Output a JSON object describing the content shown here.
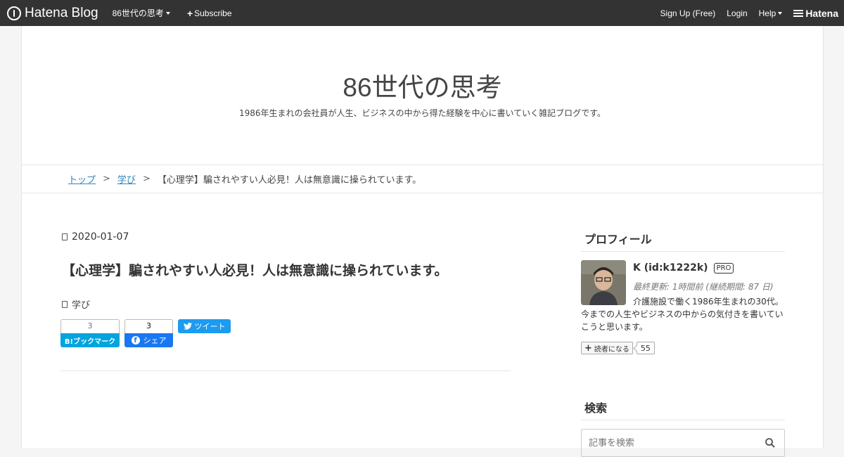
{
  "global_header": {
    "logo_text": "Hatena Blog",
    "blog_menu_label": "86世代の思考",
    "subscribe_label": "Subscribe",
    "signup_label": "Sign Up (Free)",
    "login_label": "Login",
    "help_label": "Help",
    "hatena_label": "Hatena"
  },
  "blog": {
    "title": "86世代の思考",
    "description": "1986年生まれの会社員が人生、ビジネスの中から得た経験を中心に書いていく雑記ブログです。"
  },
  "breadcrumb": {
    "items": [
      "トップ",
      "学び"
    ],
    "separator": ">",
    "current": "【心理学】騙されやすい人必見！人は無意識に操られています。"
  },
  "article": {
    "date": "2020-01-07",
    "title": "【心理学】騙されやすい人必見！人は無意識に操られています。",
    "category": "学び",
    "share": {
      "hatebu_count": "3",
      "hatebu_label": "B!ブックマーク",
      "facebook_count": "3",
      "facebook_label": "シェア",
      "twitter_label": "ツイート"
    }
  },
  "sidebar": {
    "profile": {
      "heading": "プロフィール",
      "name": "K (id:k1222k)",
      "badge": "PRO",
      "updated": "最終更新: 1時間前 (継続期間: 87 日)",
      "description": "介護施設で働く1986年生まれの30代。今までの人生やビジネスの中からの気付きを書いていこうと思います。",
      "subscribe_label": "読者になる",
      "subscriber_count": "55"
    },
    "search": {
      "heading": "検索",
      "placeholder": "記事を検索"
    }
  },
  "colors": {
    "header_bg": "#333333",
    "link": "#2e86b9",
    "hatebu": "#00a4de",
    "facebook": "#1877f2",
    "twitter": "#1d9bf0"
  }
}
